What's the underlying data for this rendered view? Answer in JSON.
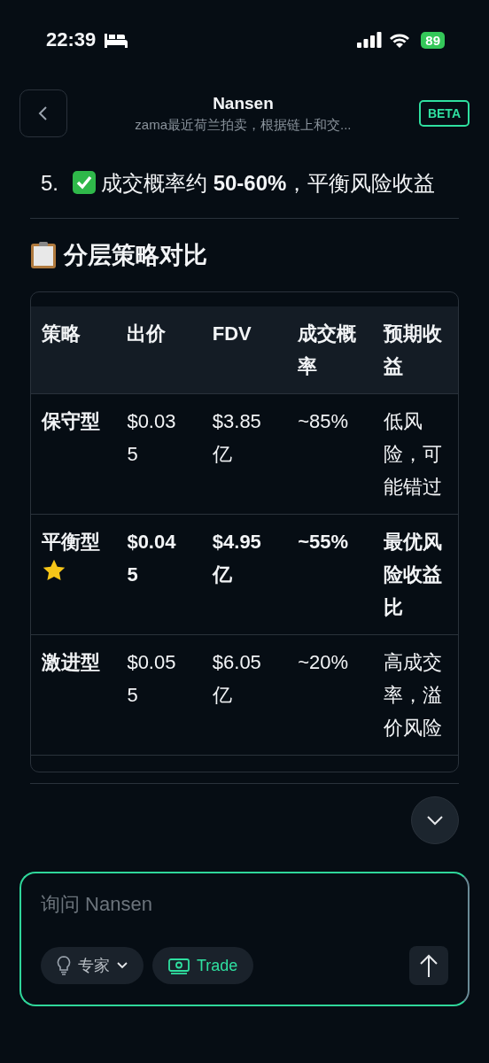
{
  "status_bar": {
    "time": "22:39",
    "battery": "89"
  },
  "header": {
    "title": "Nansen",
    "subtitle": "zama最近荷兰拍卖，根据链上和交...",
    "badge": "BETA"
  },
  "list_item": {
    "number": "5.",
    "text": "成交概率约 **50-60%**，平衡风险收益"
  },
  "section_title": "分层策略对比",
  "table": {
    "columns": [
      "策略",
      "出价",
      "FDV",
      "成交概率",
      "预期收益"
    ],
    "rows": [
      {
        "highlighted": false,
        "starred": false,
        "cells": [
          "保守型",
          "$0.035",
          "$3.85亿",
          "~85%",
          "低风险，可能错过"
        ]
      },
      {
        "highlighted": true,
        "starred": true,
        "cells": [
          "平衡型",
          "$0.045",
          "$4.95亿",
          "~55%",
          "最优风险收益比"
        ]
      },
      {
        "highlighted": false,
        "starred": false,
        "cells": [
          "激进型",
          "$0.055",
          "$6.05亿",
          "~20%",
          "高成交率，溢价风险"
        ]
      }
    ]
  },
  "composer": {
    "placeholder": "询问 Nansen",
    "mode_chip": "专家",
    "trade_chip": "Trade"
  }
}
